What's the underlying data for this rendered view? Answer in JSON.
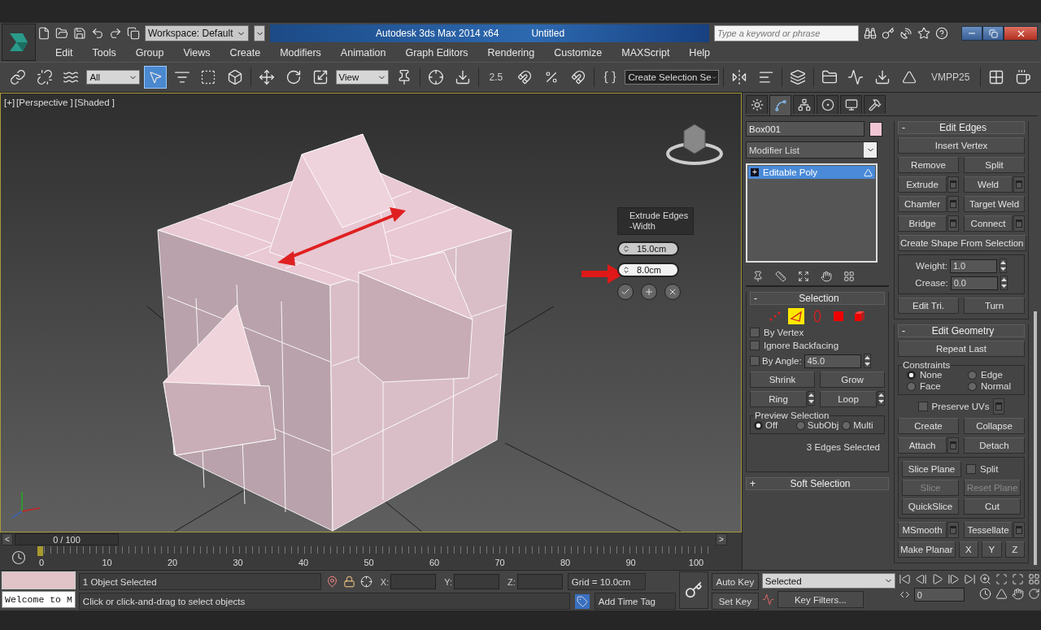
{
  "title_bar": {
    "workspace": "Workspace: Default",
    "app_title": "Autodesk 3ds Max  2014 x64",
    "file_title": "Untitled",
    "search_placeholder": "Type a keyword or phrase"
  },
  "menu": [
    "Edit",
    "Tools",
    "Group",
    "Views",
    "Create",
    "Modifiers",
    "Animation",
    "Graph Editors",
    "Rendering",
    "Customize",
    "MAXScript",
    "Help"
  ],
  "toolbar": {
    "filter": "All",
    "ref_coord": "View",
    "snap_value": "2.5",
    "selection_set": "Create Selection Se",
    "label": "VMPP25"
  },
  "viewport": {
    "labels": [
      "[+]",
      "[Perspective ]",
      "[Shaded ]"
    ],
    "caddy": {
      "title": "Extrude Edges",
      "subtitle": "-Width",
      "fields": [
        {
          "value": "15.0cm",
          "active": false
        },
        {
          "value": "8.0cm",
          "active": true
        }
      ]
    }
  },
  "command_panel": {
    "tabs": [
      {
        "kind": "create",
        "selected": false
      },
      {
        "kind": "modify",
        "selected": true
      },
      {
        "kind": "hierarchy",
        "selected": false
      },
      {
        "kind": "motion",
        "selected": false
      },
      {
        "kind": "display",
        "selected": false
      },
      {
        "kind": "utilities",
        "selected": false
      }
    ],
    "object_name": "Box001",
    "modifier_list": "Modifier List",
    "stack": [
      {
        "sign": "+",
        "label": "Editable Poly",
        "selected": true
      }
    ],
    "selection": {
      "sign": "-",
      "title": "Selection",
      "modes": [
        {
          "kind": "vertex",
          "selected": false
        },
        {
          "kind": "edge",
          "selected": true
        },
        {
          "kind": "border",
          "selected": false
        },
        {
          "kind": "polygon",
          "selected": false
        },
        {
          "kind": "element",
          "selected": false
        }
      ],
      "checks": [
        {
          "label": "By Vertex",
          "checked": false
        },
        {
          "label": "Ignore Backfacing",
          "checked": false
        }
      ],
      "by_angle": {
        "label": "By Angle:",
        "checked": false,
        "value": "45.0"
      },
      "buttons": [
        {
          "label": "Shrink",
          "spinner": false
        },
        {
          "label": "Grow",
          "spinner": false
        },
        {
          "label": "Ring",
          "spinner": true
        },
        {
          "label": "Loop",
          "spinner": true
        }
      ],
      "preview": {
        "title": "Preview Selection",
        "options": [
          {
            "label": "Off",
            "selected": true
          },
          {
            "label": "SubObj",
            "selected": false
          },
          {
            "label": "Multi",
            "selected": false
          }
        ]
      },
      "status": "3 Edges Selected"
    },
    "soft_selection": {
      "sign": "+",
      "title": "Soft Selection"
    },
    "edit_edges": {
      "sign": "-",
      "title": "Edit Edges",
      "rows": [
        [
          {
            "label": "Insert Vertex",
            "settings": false
          }
        ],
        [
          {
            "label": "Remove",
            "settings": false
          },
          {
            "label": "Split",
            "settings": false
          }
        ],
        [
          {
            "label": "Extrude",
            "settings": true
          },
          {
            "label": "Weld",
            "settings": true
          }
        ],
        [
          {
            "label": "Chamfer",
            "settings": true
          },
          {
            "label": "Target Weld",
            "settings": false
          }
        ],
        [
          {
            "label": "Bridge",
            "settings": true
          },
          {
            "label": "Connect",
            "settings": true
          }
        ],
        [
          {
            "label": "Create Shape From Selection",
            "settings": false
          }
        ]
      ],
      "fields": [
        {
          "label": "Weight:",
          "value": "1.0"
        },
        {
          "label": "Crease:",
          "value": "0.0"
        }
      ],
      "bottom": [
        {
          "label": "Edit Tri.",
          "settings": false
        },
        {
          "label": "Turn",
          "settings": false
        }
      ]
    },
    "edit_geometry": {
      "sign": "-",
      "title": "Edit Geometry",
      "repeat": "Repeat Last",
      "constraints": {
        "title": "Constraints",
        "options": [
          {
            "label": "None",
            "selected": true
          },
          {
            "label": "Edge",
            "selected": false
          },
          {
            "label": "Face",
            "selected": false
          },
          {
            "label": "Normal",
            "selected": false
          }
        ]
      },
      "preserve_uvs": {
        "label": "Preserve UVs",
        "checked": false
      },
      "rows": [
        [
          {
            "label": "Create",
            "settings": false
          },
          {
            "label": "Collapse",
            "settings": false
          }
        ],
        [
          {
            "label": "Attach",
            "settings": true
          },
          {
            "label": "Detach",
            "settings": false
          }
        ]
      ],
      "slice": [
        [
          {
            "kind": "button",
            "label": "Slice Plane",
            "disabled": false
          },
          {
            "kind": "checkbox",
            "label": "Split",
            "checked": false
          }
        ],
        [
          {
            "kind": "button",
            "label": "Slice",
            "disabled": true
          },
          {
            "kind": "button",
            "label": "Reset Plane",
            "disabled": true
          }
        ],
        [
          {
            "kind": "button",
            "label": "QuickSlice",
            "disabled": false
          },
          {
            "kind": "button",
            "label": "Cut",
            "disabled": false
          }
        ]
      ],
      "rows2": [
        [
          {
            "label": "MSmooth",
            "settings": true
          },
          {
            "label": "Tessellate",
            "settings": true
          }
        ]
      ],
      "planar": {
        "label": "Make Planar",
        "axes": [
          "X",
          "Y",
          "Z"
        ]
      }
    }
  },
  "timeline": {
    "prev": "<",
    "frame": "0 / 100",
    "next": ">",
    "ticks": [
      "0",
      "10",
      "20",
      "30",
      "40",
      "50",
      "60",
      "70",
      "80",
      "90",
      "100"
    ]
  },
  "status_bar": {
    "maxscript": "Welcome to M",
    "selection": "1 Object Selected",
    "prompt": "Click or click-and-drag to select objects",
    "coords": [
      "X:",
      "Y:",
      "Z:"
    ],
    "grid": "Grid = 10.0cm",
    "add_time_tag": "Add Time Tag",
    "auto_key": "Auto Key",
    "set_key": "Set Key",
    "key_mode": "Selected",
    "key_filters": "Key Filters...",
    "frame": "0"
  }
}
